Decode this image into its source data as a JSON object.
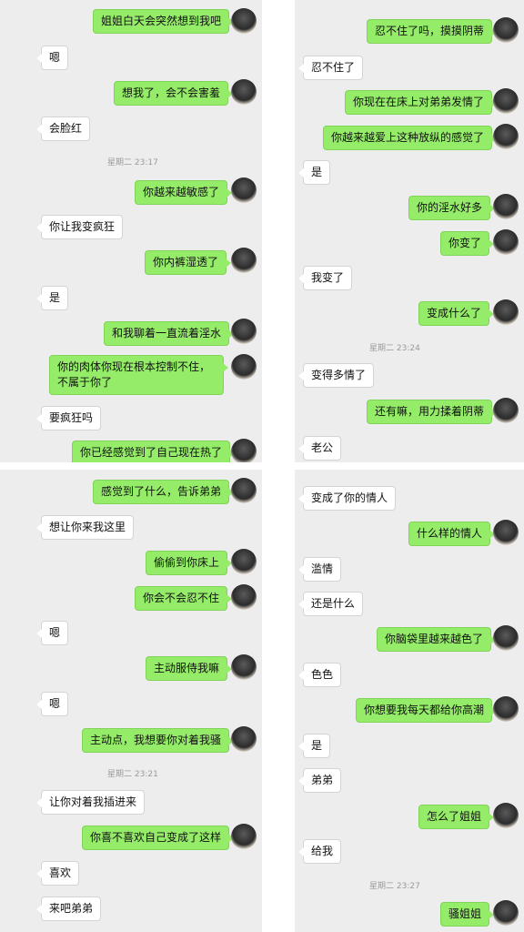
{
  "panel_top_left": {
    "messages": [
      {
        "from": "out",
        "text": "姐姐白天会突然想到我吧"
      },
      {
        "from": "in",
        "text": "嗯"
      },
      {
        "from": "out",
        "text": "想我了，会不会害羞"
      },
      {
        "from": "in",
        "text": "会脸红"
      },
      {
        "from": "out",
        "text": "你越来越敏感了"
      },
      {
        "from": "in",
        "text": "你让我变疯狂"
      },
      {
        "from": "out",
        "text": "你内裤湿透了"
      },
      {
        "from": "in",
        "text": "是"
      },
      {
        "from": "out",
        "text": "和我聊着一直流着淫水"
      },
      {
        "from": "out",
        "text": "你的肉体你现在根本控制不住，不属于你了"
      },
      {
        "from": "in",
        "text": "要疯狂吗"
      },
      {
        "from": "out",
        "text": "你已经感觉到了自己现在热了"
      }
    ],
    "timestamp": "星期二 23:17"
  },
  "panel_top_right": {
    "messages": [
      {
        "from": "out",
        "text": "忍不住了吗，摸摸阴蒂"
      },
      {
        "from": "in",
        "text": "忍不住了"
      },
      {
        "from": "out",
        "text": "你现在在床上对弟弟发情了"
      },
      {
        "from": "out",
        "text": "你越来越爱上这种放纵的感觉了"
      },
      {
        "from": "in",
        "text": "是"
      },
      {
        "from": "out",
        "text": "你的淫水好多"
      },
      {
        "from": "out",
        "text": "你变了"
      },
      {
        "from": "in",
        "text": "我变了"
      },
      {
        "from": "out",
        "text": "变成什么了"
      },
      {
        "from": "in",
        "text": "变得多情了"
      },
      {
        "from": "out",
        "text": "还有嘛，用力揉着阴蒂"
      },
      {
        "from": "in",
        "text": "老公"
      }
    ],
    "timestamp": "星期二 23:24"
  },
  "panel_bottom_left": {
    "messages": [
      {
        "from": "out",
        "text": "感觉到了什么，告诉弟弟"
      },
      {
        "from": "in",
        "text": "想让你来我这里"
      },
      {
        "from": "out",
        "text": "偷偷到你床上"
      },
      {
        "from": "out",
        "text": "你会不会忍不住"
      },
      {
        "from": "in",
        "text": "嗯"
      },
      {
        "from": "out",
        "text": "主动服侍我嘛"
      },
      {
        "from": "in",
        "text": "嗯"
      },
      {
        "from": "out",
        "text": "主动点，我想要你对着我骚"
      },
      {
        "from": "in",
        "text": "让你对着我插进来"
      },
      {
        "from": "out",
        "text": "你喜不喜欢自己变成了这样"
      },
      {
        "from": "in",
        "text": "喜欢"
      },
      {
        "from": "in",
        "text": "来吧弟弟"
      }
    ],
    "timestamp": "星期二 23:21"
  },
  "panel_bottom_right": {
    "messages": [
      {
        "from": "in",
        "text": "变成了你的情人"
      },
      {
        "from": "out",
        "text": "什么样的情人"
      },
      {
        "from": "in",
        "text": "滥情"
      },
      {
        "from": "in",
        "text": "还是什么"
      },
      {
        "from": "out",
        "text": "你脑袋里越来越色了"
      },
      {
        "from": "in",
        "text": "色色"
      },
      {
        "from": "out",
        "text": "你想要我每天都给你高潮"
      },
      {
        "from": "in",
        "text": "是"
      },
      {
        "from": "in",
        "text": "弟弟"
      },
      {
        "from": "out",
        "text": "怎么了姐姐"
      },
      {
        "from": "in",
        "text": "给我"
      },
      {
        "from": "out",
        "text": "骚姐姐"
      }
    ],
    "timestamp": "星期二 23:27"
  },
  "colors": {
    "outgoing_bubble": "#95ec69",
    "incoming_bubble": "#ffffff",
    "chat_background": "#ededed"
  }
}
